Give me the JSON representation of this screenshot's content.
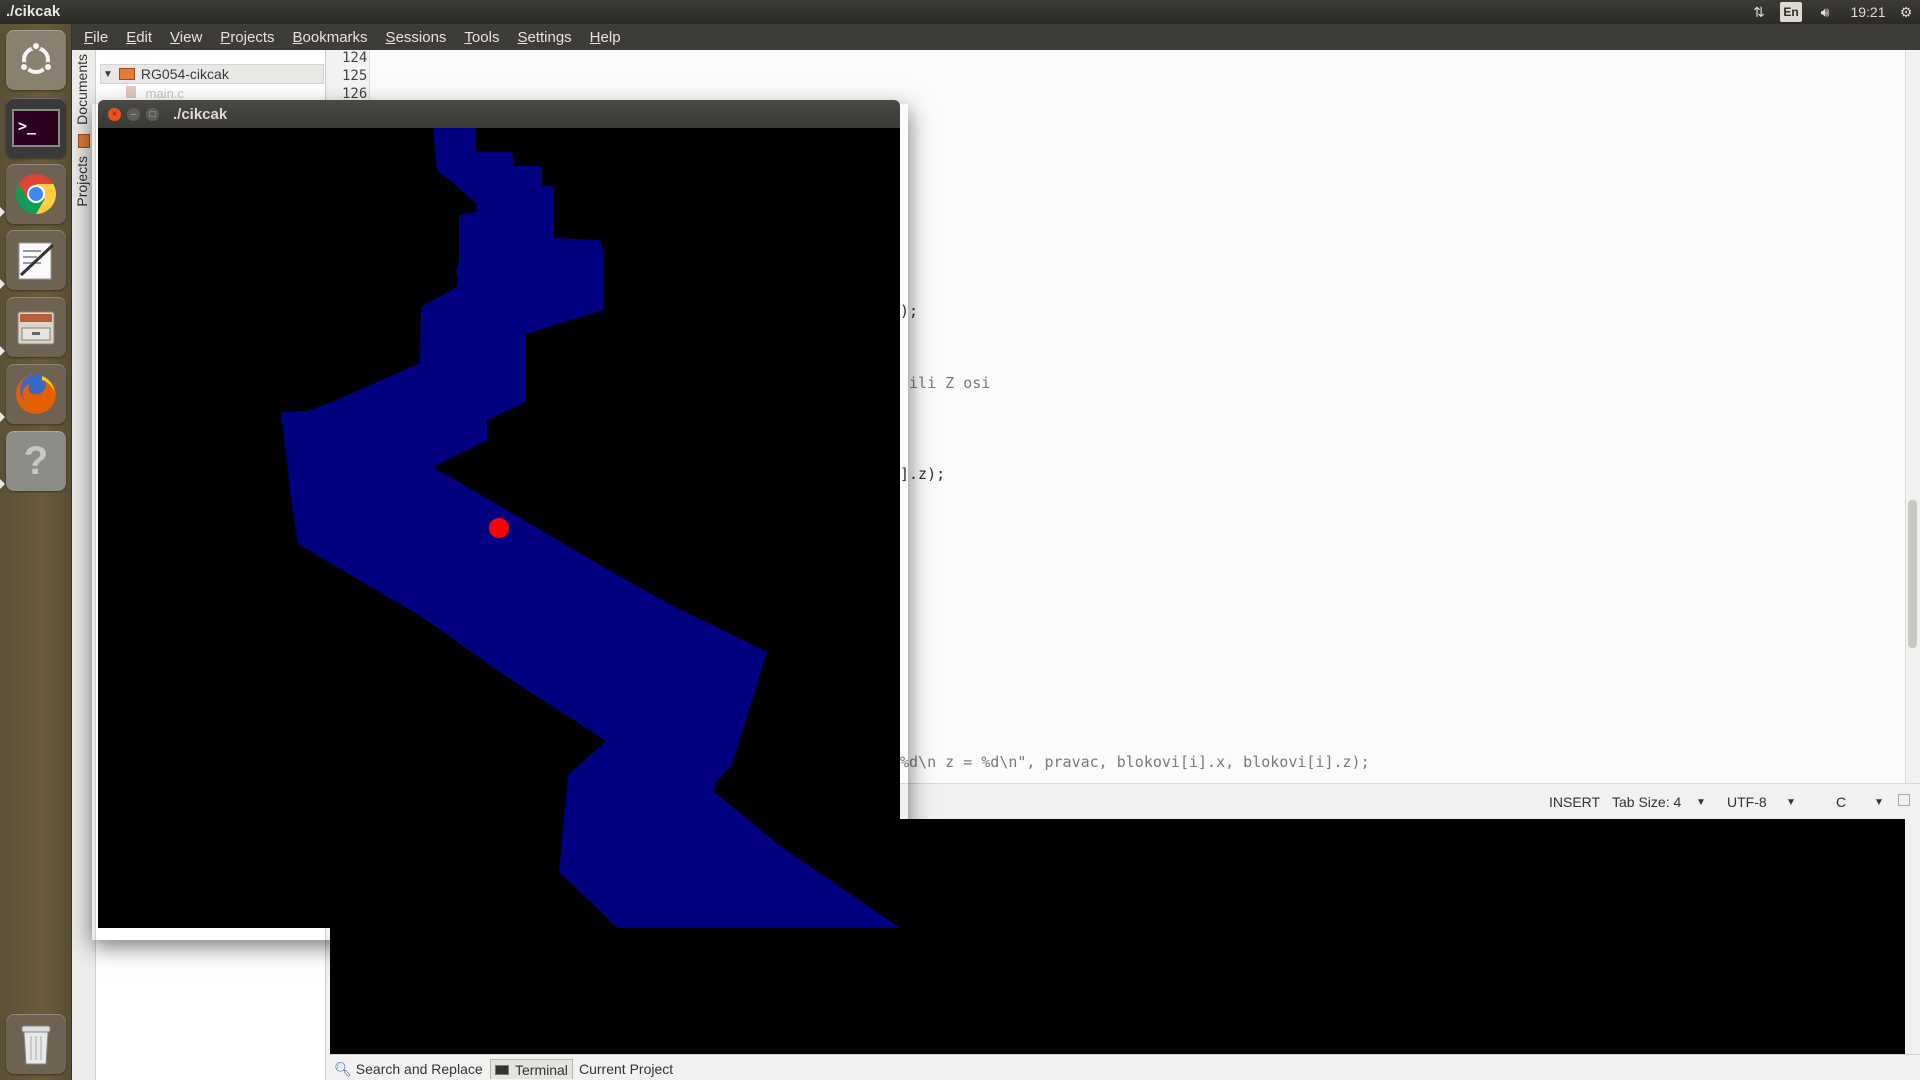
{
  "panel": {
    "title": "./cikcak",
    "clock": "19:21",
    "keyboard_layout": "En"
  },
  "launcher": {
    "items": [
      {
        "name": "ubuntu-dash",
        "icon": "ubuntu-logo-icon"
      },
      {
        "name": "terminal",
        "icon": "terminal-icon"
      },
      {
        "name": "chrome",
        "icon": "chrome-icon"
      },
      {
        "name": "text-editor",
        "icon": "text-editor-icon"
      },
      {
        "name": "file-manager",
        "icon": "file-cabinet-icon"
      },
      {
        "name": "firefox",
        "icon": "firefox-icon"
      },
      {
        "name": "help",
        "icon": "help-icon"
      },
      {
        "name": "trash",
        "icon": "trash-icon"
      }
    ]
  },
  "menubar": {
    "items": [
      "File",
      "Edit",
      "View",
      "Projects",
      "Bookmarks",
      "Sessions",
      "Tools",
      "Settings",
      "Help"
    ]
  },
  "sidebar": {
    "vertical_tabs": [
      "Documents",
      "Projects"
    ],
    "project_name": "RG054-cikcak",
    "child_file": "main.c"
  },
  "editor": {
    "line_numbers": [
      "124",
      "125",
      "126"
    ],
    "code_fragments": [
      {
        "text": ");",
        "style": "normal"
      },
      {
        "text": " ili Z osi",
        "style": "grey"
      },
      {
        "text": "].z);",
        "style": "normal"
      },
      {
        "text": "%d\\n z = %d\\n\", pravac, blokovi[i].x, blokovi[i].z);",
        "style": "grey"
      }
    ]
  },
  "statusbar": {
    "mode": "INSERT",
    "tab_size": "Tab Size: 4",
    "encoding": "UTF-8",
    "filetype": "C"
  },
  "bottom_tabs": [
    "Search and Replace",
    "Terminal",
    "Current Project"
  ],
  "game_window": {
    "title": "./cikcak",
    "colors": {
      "background": "#000000",
      "path": "#000080",
      "ball": "#ff0000"
    }
  }
}
